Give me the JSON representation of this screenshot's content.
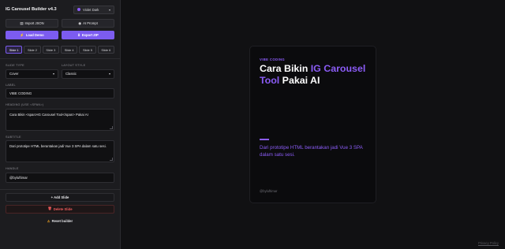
{
  "app": {
    "title": "IG Carousel Builder v4.3",
    "theme_select": {
      "value": "Violet Dark",
      "accent_color": "#8b5cf6"
    }
  },
  "toolbar": {
    "import_json_label": "Import JSON",
    "ai_prompt_label": "AI Prompt",
    "load_demo_label": "Load Demo",
    "export_zip_label": "Export ZIP"
  },
  "slide_tabs": [
    "Slide 1",
    "Slide 2",
    "Slide 3",
    "Slide 4",
    "Slide 5",
    "Slide 6"
  ],
  "active_slide_index": 0,
  "form": {
    "slide_type": {
      "label": "SLIDE TYPE",
      "value": "Cover"
    },
    "layout_style": {
      "label": "LAYOUT STYLE",
      "value": "Classic"
    },
    "label_field": {
      "label": "LABEL",
      "value": "VIBE CODING"
    },
    "heading_field": {
      "label": "HEADING (USE <SPAN>)",
      "value": "Cara Bikin <span>IG Carousel Tool</span> Pakai AI"
    },
    "subtitle_field": {
      "label": "SUBTITLE",
      "value": "Dari prototipe HTML berantakan jadi Vue 3 SPA dalam satu sesi."
    },
    "handle_field": {
      "label": "HANDLE",
      "value": "@byluftimar"
    }
  },
  "actions": {
    "add_slide_label": "+ Add Slide",
    "delete_slide_label": "Delete Slide",
    "reset_builder_label": "Reset builder"
  },
  "preview": {
    "kicker": "VIBE CODING",
    "heading_before": "Cara Bikin ",
    "heading_highlight": "IG Carousel Tool",
    "heading_after": " Pakai AI",
    "subtitle": "Dari prototipe HTML berantakan jadi Vue 3 SPA dalam satu sesi.",
    "handle": "@byluftimar"
  },
  "footer": {
    "privacy_label": "Privacy Policy"
  },
  "colors": {
    "accent": "#8b5cf6",
    "danger": "#ef5b5b",
    "sidebar_bg": "#1c1c1f",
    "canvas_bg": "#111113"
  }
}
